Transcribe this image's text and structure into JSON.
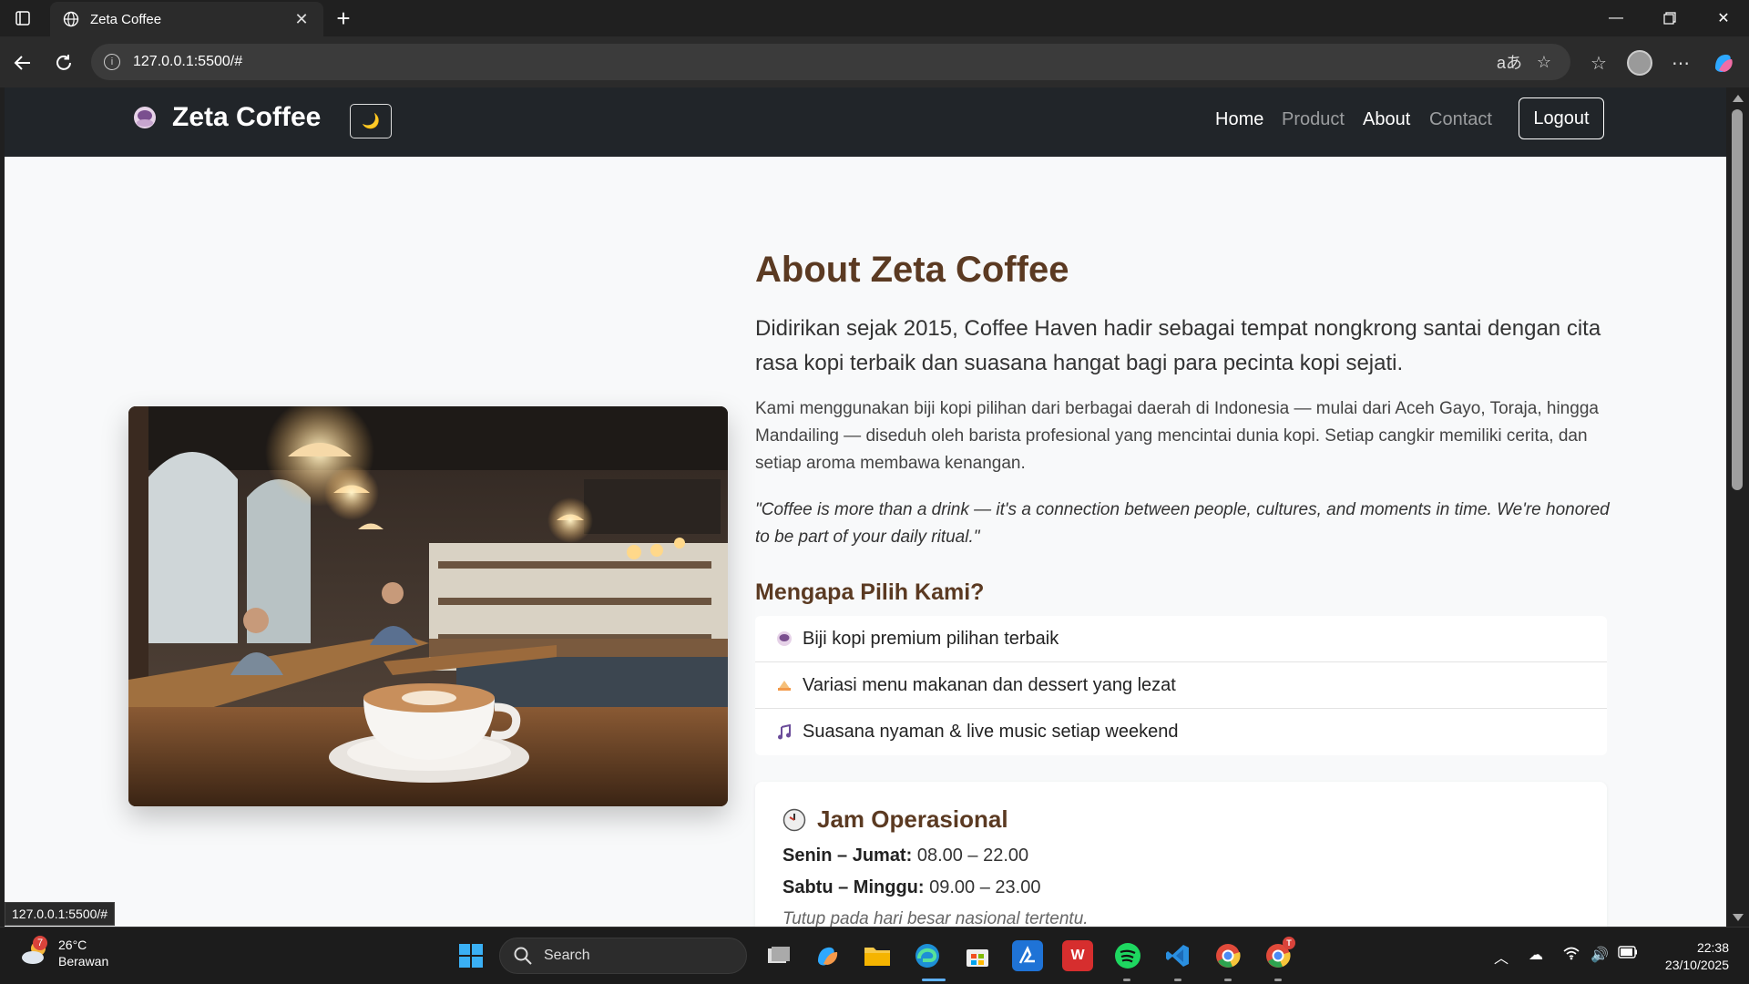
{
  "browser": {
    "tab_title": "Zeta Coffee",
    "new_tab_glyph": "+",
    "url": "127.0.0.1:5500/#",
    "status_url": "127.0.0.1:5500/#",
    "translate_glyph": "aあ"
  },
  "nav": {
    "brand": "Zeta Coffee",
    "dark_toggle_icon": "🌙",
    "links": [
      {
        "label": "Home",
        "active": true
      },
      {
        "label": "Product",
        "active": false
      },
      {
        "label": "About",
        "active": true
      },
      {
        "label": "Contact",
        "active": false
      }
    ],
    "logout_label": "Logout"
  },
  "about": {
    "title": "About Zeta Coffee",
    "lead": "Didirikan sejak 2015, Coffee Haven hadir sebagai tempat nongkrong santai dengan cita rasa kopi terbaik dan suasana hangat bagi para pecinta kopi sejati.",
    "paragraph": "Kami menggunakan biji kopi pilihan dari berbagai daerah di Indonesia — mulai dari Aceh Gayo, Toraja, hingga Mandailing — diseduh oleh barista profesional yang mencintai dunia kopi. Setiap cangkir memiliki cerita, dan setiap aroma membawa kenangan.",
    "quote": "\"Coffee is more than a drink — it's a connection between people, cultures, and moments in time. We're honored to be part of your daily ritual.\""
  },
  "why": {
    "title": "Mengapa Pilih Kami?",
    "items": [
      {
        "icon": "coffee-bean-icon",
        "label": "Biji kopi premium pilihan terbaik"
      },
      {
        "icon": "cake-icon",
        "label": "Variasi menu makanan dan dessert yang lezat"
      },
      {
        "icon": "music-icon",
        "label": "Suasana nyaman & live music setiap weekend"
      }
    ]
  },
  "hours": {
    "title": "Jam Operasional",
    "rows": [
      {
        "days": "Senin – Jumat:",
        "time": "08.00 – 22.00"
      },
      {
        "days": "Sabtu – Minggu:",
        "time": "09.00 – 23.00"
      }
    ],
    "note": "Tutup pada hari besar nasional tertentu."
  },
  "taskbar": {
    "weather_temp": "26°C",
    "weather_cond": "Berawan",
    "weather_badge": "7",
    "search_label": "Search",
    "time": "22:38",
    "date": "23/10/2025",
    "wps_glyph": "W",
    "chrome_badge": "T"
  },
  "colors": {
    "nav_bg": "#212529",
    "heading_brown": "#5b3a22",
    "page_bg": "#f8f9fa"
  }
}
